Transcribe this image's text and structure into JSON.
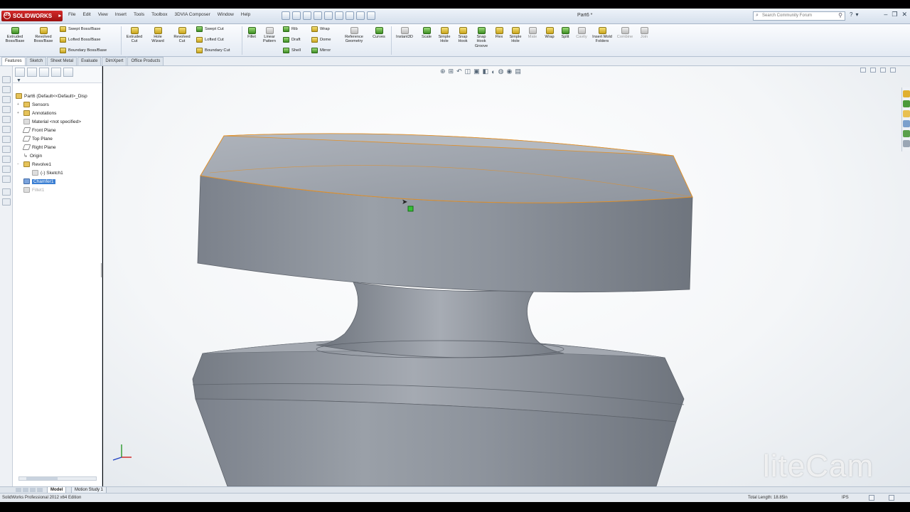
{
  "app": {
    "logo": "SOLIDWORKS",
    "doc_title": "Part6 *"
  },
  "menu": [
    "File",
    "Edit",
    "View",
    "Insert",
    "Tools",
    "Toolbox",
    "3DVIA Composer",
    "Window",
    "Help"
  ],
  "search": {
    "placeholder": "Search Community Forum"
  },
  "ribbon": {
    "extruded_boss": "Extruded Boss/Base",
    "revolved_boss": "Revolved Boss/Base",
    "swept_boss": "Swept Boss/Base",
    "lofted_boss": "Lofted Boss/Base",
    "boundary_boss": "Boundary Boss/Base",
    "extruded_cut": "Extruded Cut",
    "hole_wizard": "Hole Wizard",
    "revolved_cut": "Revolved Cut",
    "swept_cut": "Swept Cut",
    "lofted_cut": "Lofted Cut",
    "boundary_cut": "Boundary Cut",
    "fillet": "Fillet",
    "linear_pattern": "Linear Pattern",
    "rib": "Rib",
    "draft": "Draft",
    "shell": "Shell",
    "wrap": "Wrap",
    "dome": "Dome",
    "mirror": "Mirror",
    "reference_geometry": "Reference Geometry",
    "curves": "Curves",
    "instant3d": "Instant3D",
    "scale": "Scale",
    "simple_hole": "Simple Hole",
    "snap_hook": "Snap Hook",
    "snap_hook_groove": "Snap Hook Groove",
    "flex": "Flex",
    "simple_hole2": "Simple Hole",
    "mate": "Mate",
    "wrap2": "Wrap",
    "split": "Split",
    "cavity": "Cavity",
    "insert_mold_folders": "Insert Mold Folders",
    "combine": "Combine",
    "join": "Join"
  },
  "cm_tabs": [
    "Features",
    "Sketch",
    "Sheet Metal",
    "Evaluate",
    "DimXpert",
    "Office Products"
  ],
  "tree": {
    "part": "Part6 (Default<<Default>_Disp",
    "sensors": "Sensors",
    "annotations": "Annotations",
    "material": "Material <not specified>",
    "front_plane": "Front Plane",
    "top_plane": "Top Plane",
    "right_plane": "Right Plane",
    "origin": "Origin",
    "revolve1": "Revolve1",
    "sketch": "(-) Sketch1",
    "chamfer1": "Chamfer1",
    "fillet1": "Fillet1"
  },
  "model_tabs": [
    "Model",
    "Motion Study 1"
  ],
  "status": {
    "edition": "SolidWorks Professional 2012 x64 Edition",
    "measure": "Total Length: 18.85in",
    "units": "IPS"
  },
  "watermark": "liteCam",
  "colors": {
    "accent": "#3b7fd3",
    "model": "#8a8f98",
    "edge_highlight": "#e0902a",
    "logo_red": "#c41f1f"
  }
}
